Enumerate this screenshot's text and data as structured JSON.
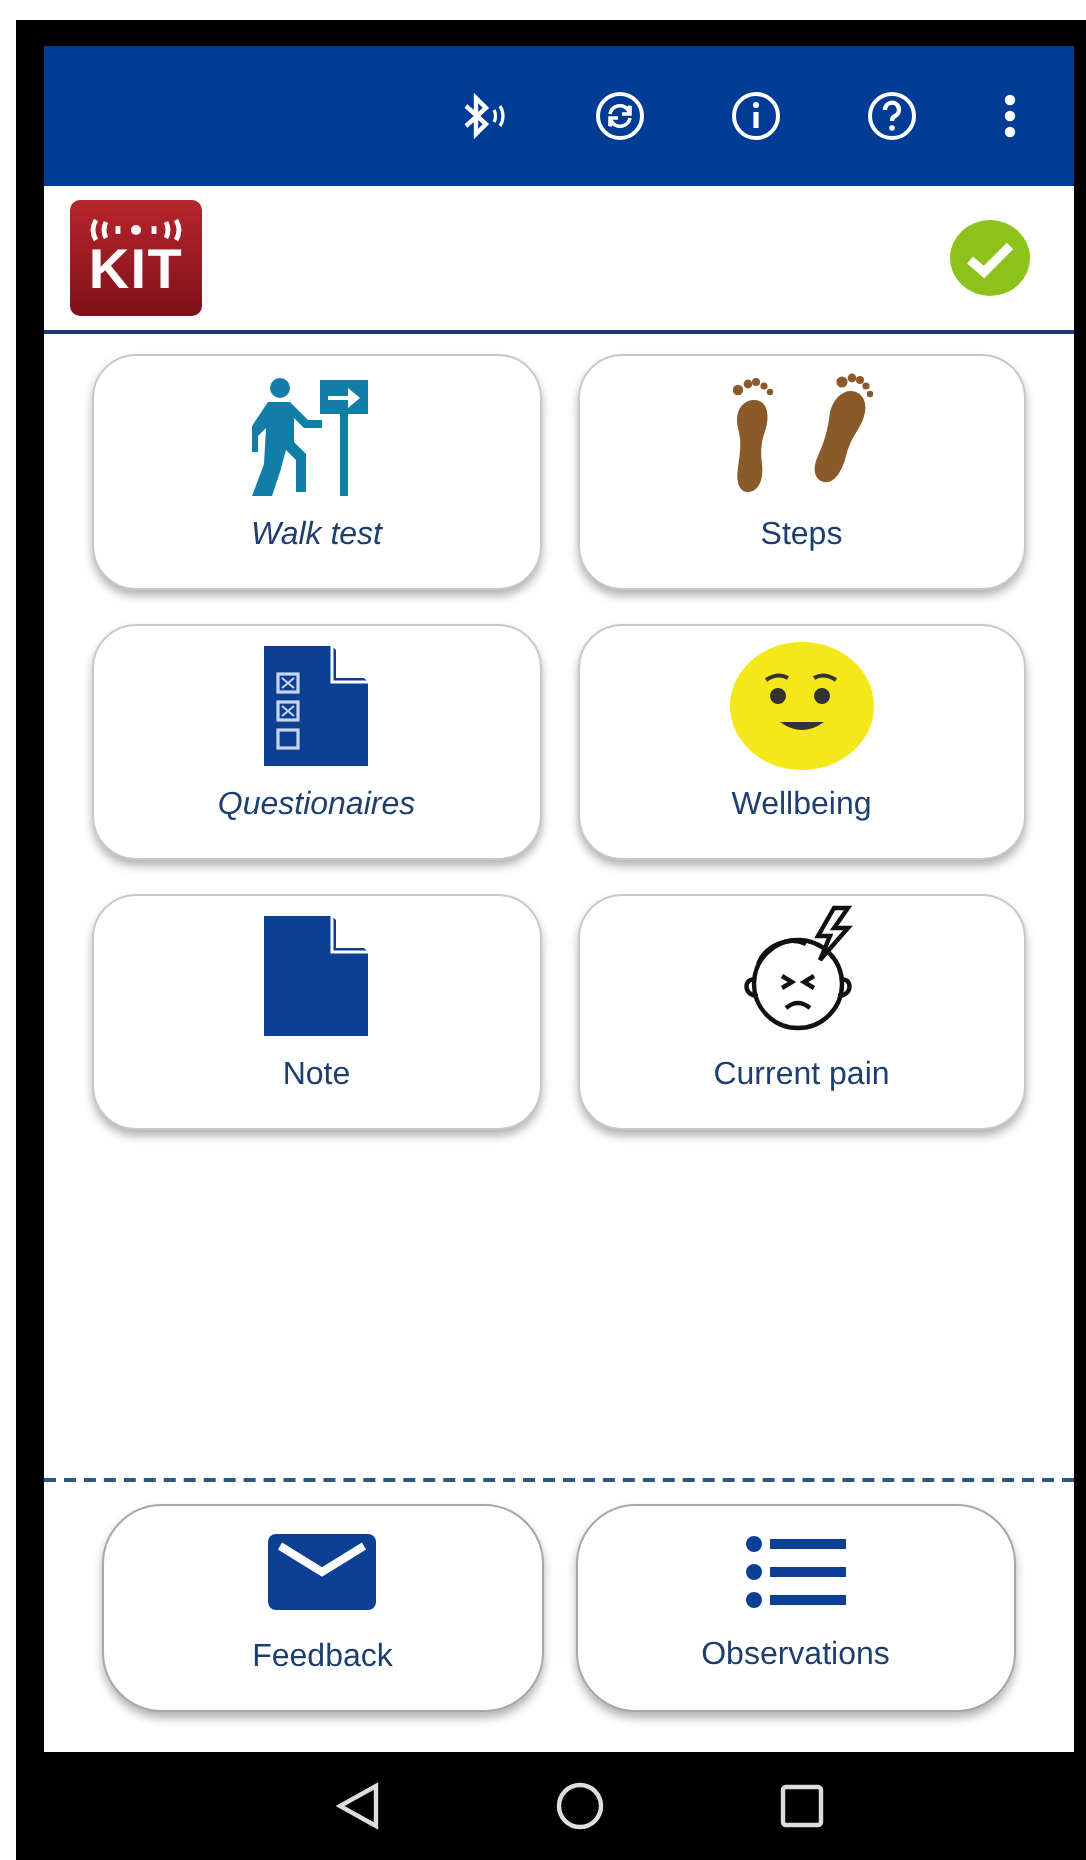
{
  "app_bar": {
    "actions": [
      {
        "kind": "bluetooth"
      },
      {
        "kind": "sync"
      },
      {
        "kind": "info"
      },
      {
        "kind": "help"
      },
      {
        "kind": "more"
      }
    ]
  },
  "header": {
    "logo_text": "KIT",
    "connected": true
  },
  "tiles": [
    {
      "label": "Walk test",
      "italic": true,
      "kind": "walk"
    },
    {
      "label": "Steps",
      "italic": false,
      "kind": "steps"
    },
    {
      "label": "Questionaires",
      "italic": true,
      "kind": "questionnaire"
    },
    {
      "label": "Wellbeing",
      "italic": false,
      "kind": "smiley"
    },
    {
      "label": "Note",
      "italic": false,
      "kind": "note"
    },
    {
      "label": "Current pain",
      "italic": false,
      "kind": "pain"
    }
  ],
  "bottom_buttons": [
    {
      "label": "Feedback",
      "kind": "mail"
    },
    {
      "label": "Observations",
      "kind": "list"
    }
  ],
  "nav_bar": [
    {
      "kind": "back"
    },
    {
      "kind": "home"
    },
    {
      "kind": "recents"
    }
  ]
}
